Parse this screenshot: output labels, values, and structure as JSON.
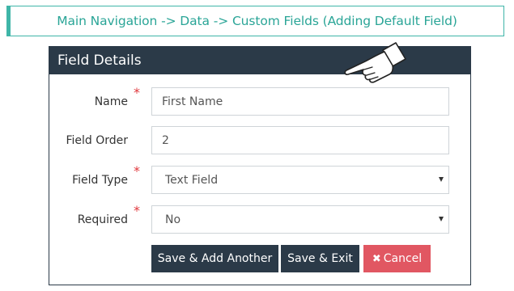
{
  "breadcrumb": {
    "text": "Main Navigation -> Data -> Custom Fields (Adding Default Field)"
  },
  "panel": {
    "title": "Field Details"
  },
  "form": {
    "required_marker": "*",
    "name": {
      "label": "Name",
      "value": "First Name"
    },
    "field_order": {
      "label": "Field Order",
      "value": "2"
    },
    "field_type": {
      "label": "Field Type",
      "value": "Text Field"
    },
    "required": {
      "label": "Required",
      "value": "No"
    }
  },
  "buttons": {
    "save_add": "Save & Add Another",
    "save_exit": "Save & Exit",
    "cancel_icon": "✖",
    "cancel": "Cancel"
  },
  "icons": {
    "pointer": "pointing-hand-icon",
    "caret": "caret-down-icon",
    "cancel": "close-icon"
  },
  "colors": {
    "accent": "#3fb5a8",
    "panel": "#2b3a48",
    "danger": "#e15762",
    "required": "#e0393e"
  }
}
